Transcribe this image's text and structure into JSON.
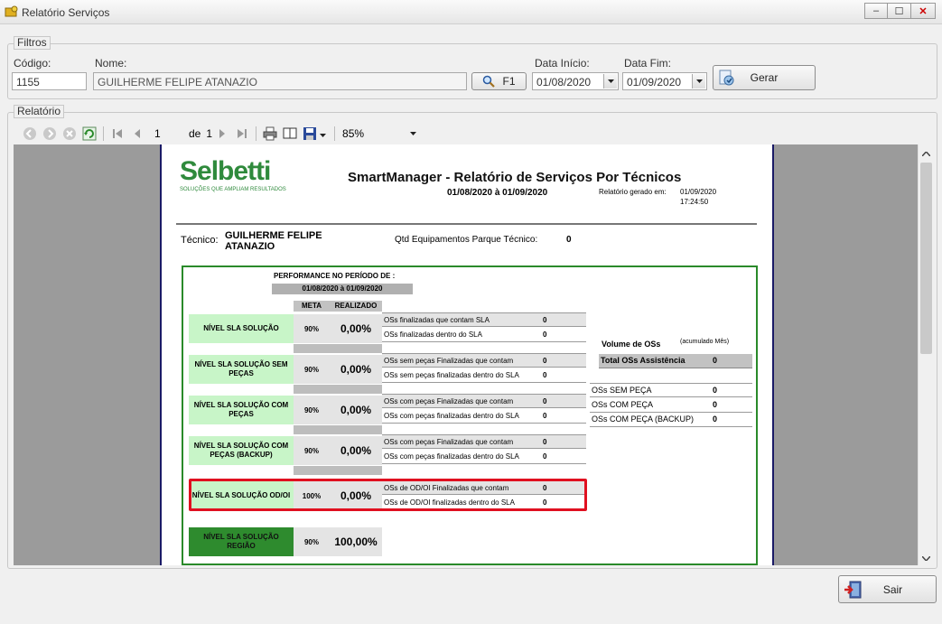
{
  "window": {
    "title": "Relatório Serviços",
    "minimize": "–",
    "maximize": "☐",
    "close": "✕"
  },
  "filtros": {
    "legend": "Filtros",
    "codigo_label": "Código:",
    "codigo_value": "1155",
    "nome_label": "Nome:",
    "nome_value": "GUILHERME FELIPE ATANAZIO",
    "search_button": "F1",
    "data_inicio_label": "Data Início:",
    "data_inicio_value": "01/08/2020",
    "data_fim_label": "Data Fim:",
    "data_fim_value": "01/09/2020",
    "gerar_button": "Gerar"
  },
  "relatorio": {
    "legend": "Relatório",
    "toolbar": {
      "page": "1",
      "of_label": "de",
      "total_pages": "1",
      "zoom": "85%"
    }
  },
  "report": {
    "logo": "Selbetti",
    "logo_tagline": "SOLUÇÕES QUE AMPLIAM RESULTADOS",
    "title": "SmartManager - Relatório de Serviços Por Técnicos",
    "period": "01/08/2020 à 01/09/2020",
    "generated_label": "Relatório gerado em:",
    "generated_date": "01/09/2020",
    "generated_time": "17:24:50",
    "tecnico_label": "Técnico:",
    "tecnico_name": "GUILHERME FELIPE ATANAZIO",
    "qtd_label": "Qtd Equipamentos Parque Técnico:",
    "qtd_value": "0",
    "performance_header": "PERFORMANCE NO PERÍODO DE :",
    "performance_period": "01/08/2020 à 01/09/2020",
    "col_meta": "META",
    "col_realizado": "REALIZADO",
    "levels": [
      {
        "name": "NÍVEL SLA SOLUÇÃO",
        "meta": "90%",
        "realizado": "0,00%",
        "rows": [
          {
            "label": "OSs finalizadas que contam SLA",
            "value": "0"
          },
          {
            "label": "OSs finalizadas dentro do SLA",
            "value": "0"
          }
        ]
      },
      {
        "name": "NÍVEL SLA SOLUÇÃO SEM PEÇAS",
        "meta": "90%",
        "realizado": "0,00%",
        "rows": [
          {
            "label": "OSs sem peças Finalizadas que contam",
            "value": "0"
          },
          {
            "label": "OSs sem peças finalizadas dentro do SLA",
            "value": "0"
          }
        ]
      },
      {
        "name": "NÍVEL SLA SOLUÇÃO COM PEÇAS",
        "meta": "90%",
        "realizado": "0,00%",
        "rows": [
          {
            "label": "OSs com peças Finalizadas que contam",
            "value": "0"
          },
          {
            "label": "OSs com peças finalizadas dentro do SLA",
            "value": "0"
          }
        ]
      },
      {
        "name": "NÍVEL SLA SOLUÇÃO COM PEÇAS (BACKUP)",
        "meta": "90%",
        "realizado": "0,00%",
        "rows": [
          {
            "label": "OSs com peças Finalizadas que contam",
            "value": "0"
          },
          {
            "label": "OSs com peças finalizadas dentro do SLA",
            "value": "0"
          }
        ]
      },
      {
        "name": "NÍVEL SLA SOLUÇÃO OD/OI",
        "meta": "100%",
        "realizado": "0,00%",
        "rows": [
          {
            "label": "OSs de OD/OI Finalizadas que contam",
            "value": "0"
          },
          {
            "label": "OSs de OD/OI finalizadas dentro do SLA",
            "value": "0"
          }
        ]
      },
      {
        "name": "NÍVEL SLA SOLUÇÃO REGIÃO",
        "meta": "90%",
        "realizado": "100,00%",
        "rows": []
      }
    ],
    "volume": {
      "title": "Volume de OSs",
      "subtitle": "(acumulado Mês)",
      "total_label": "Total OSs Assistência",
      "total_value": "0",
      "rows": [
        {
          "label": "OSs SEM PEÇA",
          "value": "0"
        },
        {
          "label": "OSs COM PEÇA",
          "value": "0"
        },
        {
          "label": "OSs COM PEÇA (BACKUP)",
          "value": "0"
        }
      ]
    }
  },
  "footer": {
    "sair_button": "Sair"
  },
  "colors": {
    "accent_green": "#2f8a3c",
    "highlight_red": "#e01020",
    "panel_border": "#2a8a2a"
  }
}
